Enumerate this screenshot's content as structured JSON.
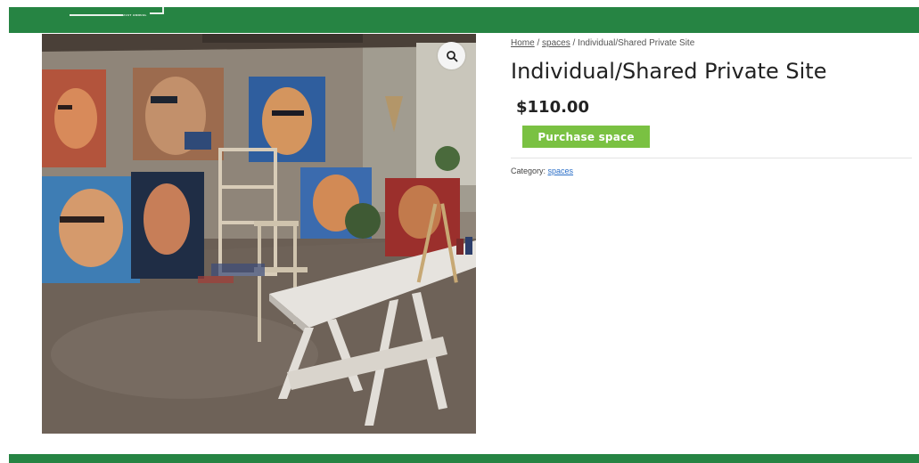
{
  "header": {
    "logo_tag": "21ST ANNUAL"
  },
  "breadcrumb": {
    "home": "Home",
    "sep1": " / ",
    "spaces": "spaces",
    "sep2": " / ",
    "current": "Individual/Shared Private Site"
  },
  "product": {
    "title": "Individual/Shared Private Site",
    "price": "$110.00",
    "purchase_label": "Purchase space",
    "category_label": "Category: ",
    "category_link": "spaces",
    "image_icon": "magnifier-icon"
  },
  "colors": {
    "brand_green": "#268443",
    "button_green": "#7ac142",
    "link_blue": "#2a6ec7"
  }
}
